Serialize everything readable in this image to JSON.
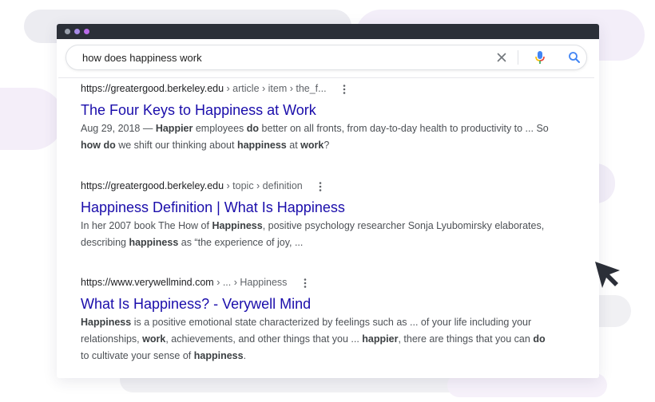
{
  "window": {
    "dots": [
      {
        "name": "dot-grey",
        "color": "#9aa0ad"
      },
      {
        "name": "dot-violet",
        "color": "#a78be6"
      },
      {
        "name": "dot-purple",
        "color": "#b96be8"
      }
    ]
  },
  "search": {
    "query": "how does happiness work",
    "icons": {
      "clear": "close-icon",
      "voice": "mic-icon",
      "submit": "search-icon"
    }
  },
  "results": [
    {
      "domain": "https://greatergood.berkeley.edu",
      "path": " › article › item › the_f...",
      "title": "The Four Keys to Happiness at Work",
      "snippet_parts": [
        {
          "t": "Aug 29, 2018 — ",
          "b": false
        },
        {
          "t": "Happier",
          "b": true
        },
        {
          "t": " employees ",
          "b": false
        },
        {
          "t": "do",
          "b": true
        },
        {
          "t": " better on all fronts, from day-to-day health to productivity to ... So ",
          "b": false
        },
        {
          "t": "how do",
          "b": true
        },
        {
          "t": " we shift our thinking about ",
          "b": false
        },
        {
          "t": "happiness",
          "b": true
        },
        {
          "t": " at ",
          "b": false
        },
        {
          "t": "work",
          "b": true
        },
        {
          "t": "?",
          "b": false
        }
      ]
    },
    {
      "domain": "https://greatergood.berkeley.edu",
      "path": " › topic › definition",
      "title": "Happiness Definition | What Is Happiness",
      "snippet_parts": [
        {
          "t": "In her 2007 book The How of ",
          "b": false
        },
        {
          "t": "Happiness",
          "b": true
        },
        {
          "t": ", positive psychology researcher Sonja Lyubomirsky elaborates, describing ",
          "b": false
        },
        {
          "t": "happiness",
          "b": true
        },
        {
          "t": " as “the experience of joy, ...",
          "b": false
        }
      ]
    },
    {
      "domain": "https://www.verywellmind.com",
      "path": " › ... › Happiness",
      "title": "What Is Happiness? - Verywell Mind",
      "snippet_parts": [
        {
          "t": "Happiness",
          "b": true
        },
        {
          "t": " is a positive emotional state characterized by feelings such as ... of your life including your relationships, ",
          "b": false
        },
        {
          "t": "work",
          "b": true
        },
        {
          "t": ", achievements, and other things that you ... ",
          "b": false
        },
        {
          "t": "happier",
          "b": true
        },
        {
          "t": ", there are things that you can ",
          "b": false
        },
        {
          "t": "do",
          "b": true
        },
        {
          "t": " to cultivate your sense of ",
          "b": false
        },
        {
          "t": "happiness",
          "b": true
        },
        {
          "t": ".",
          "b": false
        }
      ]
    }
  ],
  "colors": {
    "link": "#1a0dab",
    "titlebar": "#2b2f38",
    "mic_blue": "#4285f4",
    "mic_red": "#ea4335",
    "mic_yellow": "#fbbc05",
    "mic_green": "#34a853",
    "cursor": "#2b2f38"
  }
}
